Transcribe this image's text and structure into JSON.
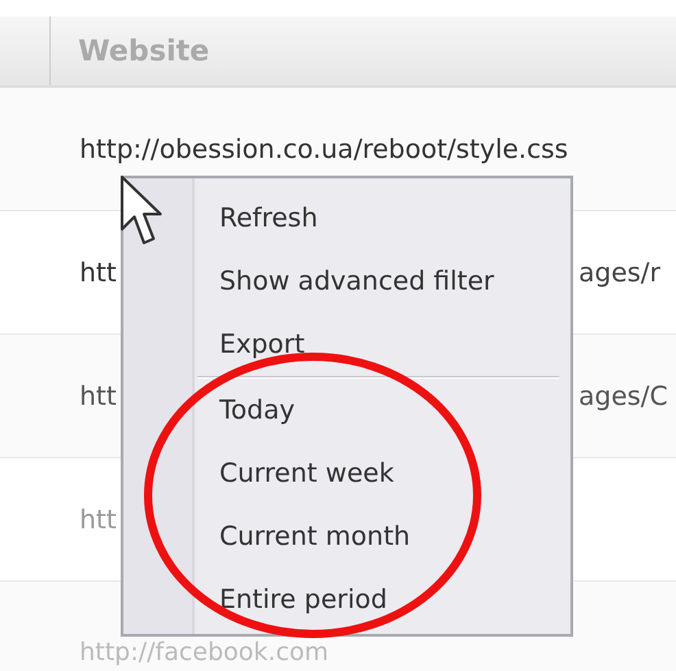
{
  "table": {
    "columns": [
      "Website"
    ],
    "rows": [
      {
        "text": "http://obession.co.ua/reboot/style.css"
      },
      {
        "text": "htt",
        "text_right": "ages/r"
      },
      {
        "text": "htt",
        "text_right": "ages/C"
      },
      {
        "text": "htt"
      },
      {
        "text": "http://facebook.com"
      }
    ]
  },
  "context_menu": {
    "groups": [
      [
        "Refresh",
        "Show advanced filter",
        "Export"
      ],
      [
        "Today",
        "Current week",
        "Current month",
        "Entire period"
      ]
    ]
  }
}
